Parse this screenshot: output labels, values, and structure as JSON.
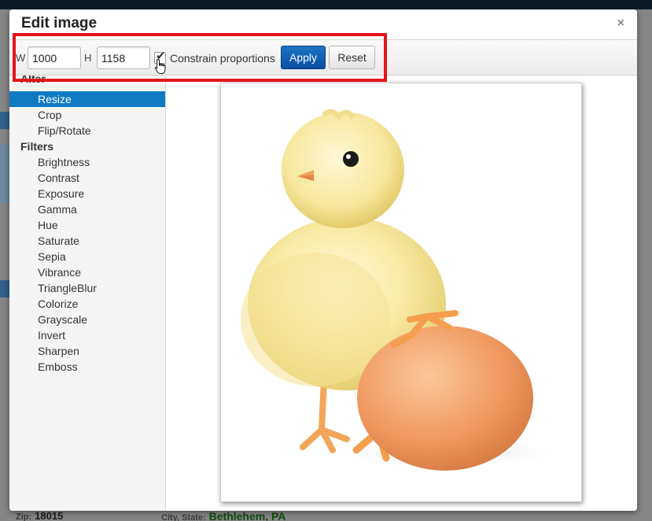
{
  "dialog": {
    "title": "Edit image",
    "close_glyph": "×"
  },
  "toolbar": {
    "width_label": "W",
    "width_value": "1000",
    "height_label": "H",
    "height_value": "1158",
    "constrain_label": "Constrain proportions",
    "constrain_checked": true,
    "apply_label": "Apply",
    "reset_label": "Reset"
  },
  "sidebar": {
    "sections": [
      {
        "title": "Alter",
        "items": [
          {
            "label": "Resize",
            "active": true
          },
          {
            "label": "Crop"
          },
          {
            "label": "Flip/Rotate"
          }
        ]
      },
      {
        "title": "Filters",
        "items": [
          {
            "label": "Brightness"
          },
          {
            "label": "Contrast"
          },
          {
            "label": "Exposure"
          },
          {
            "label": "Gamma"
          },
          {
            "label": "Hue"
          },
          {
            "label": "Saturate"
          },
          {
            "label": "Sepia"
          },
          {
            "label": "Vibrance"
          },
          {
            "label": "TriangleBlur"
          },
          {
            "label": "Colorize"
          },
          {
            "label": "Grayscale"
          },
          {
            "label": "Invert"
          },
          {
            "label": "Sharpen"
          },
          {
            "label": "Emboss"
          }
        ]
      }
    ]
  },
  "background_page": {
    "zip_label": "Zip:",
    "zip_value": "18015",
    "city_label": "City, State:",
    "city_value": "Bethlehem, PA"
  },
  "colors": {
    "accent": "#0f7bc2",
    "apply_button": "#0a4fa3",
    "highlight_box": "#e3141b"
  },
  "icons": {
    "close": "close-icon",
    "checkbox": "check-icon",
    "pointer": "hand-cursor-icon"
  }
}
